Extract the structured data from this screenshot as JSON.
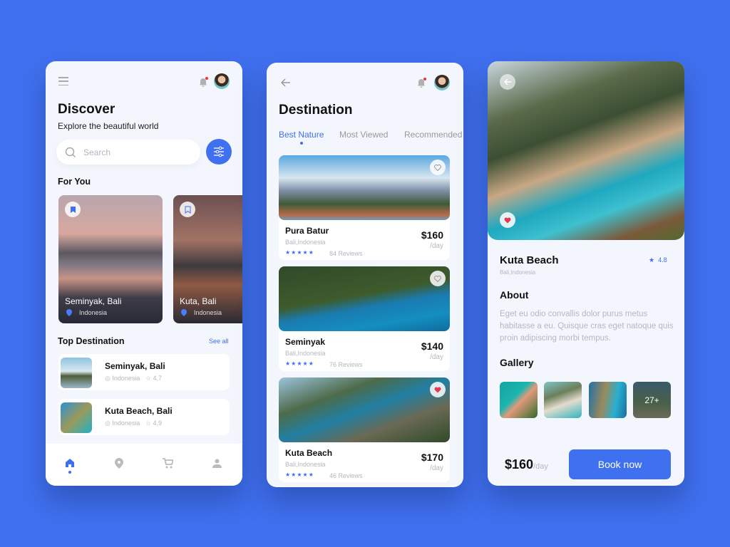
{
  "colors": {
    "background": "#3f70ef",
    "accent": "#3f70ef",
    "heart": "#e53950"
  },
  "discover": {
    "title": "Discover",
    "subtitle": "Explore the beautiful world",
    "search_placeholder": "Search",
    "for_you_title": "For You",
    "for_you": [
      {
        "name": "Seminyak, Bali",
        "country": "Indonesia",
        "bookmarked": true
      },
      {
        "name": "Kuta, Bali",
        "country": "Indonesia",
        "bookmarked": false
      }
    ],
    "top_title": "Top Destination",
    "see_all": "See all",
    "top": [
      {
        "name": "Seminyak, Bali",
        "country": "Indonesia",
        "rating": "4,7"
      },
      {
        "name": "Kuta Beach, Bali",
        "country": "Indonesia",
        "rating": "4,9"
      }
    ],
    "nav": [
      "home-icon",
      "location-icon",
      "cart-icon",
      "user-icon"
    ],
    "active_nav": "home"
  },
  "destination": {
    "title": "Destination",
    "tabs": [
      "Best Nature",
      "Most Viewed",
      "Recommended"
    ],
    "active_tab": "Best Nature",
    "items": [
      {
        "name": "Pura Batur",
        "location": "Bali,Indonesia",
        "price": "$160",
        "unit": "/day",
        "stars": "★★★★★",
        "reviews": "84 Reviews",
        "liked": false
      },
      {
        "name": "Seminyak",
        "location": "Bali,Indonesia",
        "price": "$140",
        "unit": "/day",
        "stars": "★★★★★",
        "reviews": "76 Reviews",
        "liked": false
      },
      {
        "name": "Kuta Beach",
        "location": "Bali,Indonesia",
        "price": "$170",
        "unit": "/day",
        "stars": "★★★★★",
        "reviews": "46 Reviews",
        "liked": true
      }
    ]
  },
  "detail": {
    "name": "Kuta Beach",
    "location": "Bali,Indonesia",
    "rating": "4.8",
    "about_title": "About",
    "about": "Eget eu odio convallis dolor purus metus habitasse a eu. Quisque cras eget natoque quis proin adipiscing morbi tempus.",
    "gallery_title": "Gallery",
    "gallery_more": "27+",
    "price": "$160",
    "unit": "/day",
    "book": "Book now"
  }
}
